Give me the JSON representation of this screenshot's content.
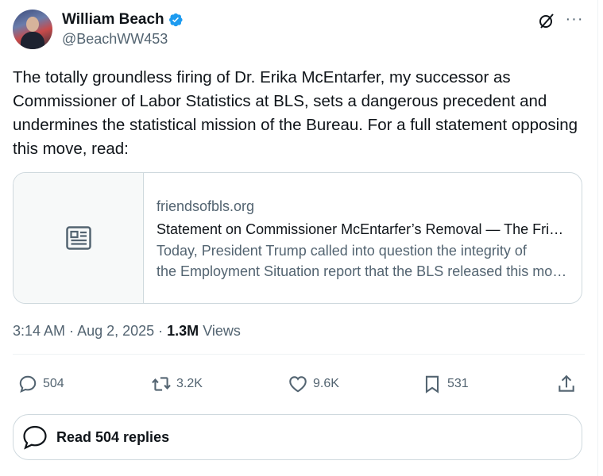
{
  "author": {
    "name": "William Beach",
    "handle": "@BeachWW453",
    "verified_color": "#1d9bf0"
  },
  "tweet": {
    "text": "The totally groundless firing of Dr. Erika McEntarfer, my successor as Commissioner of Labor Statistics at BLS, sets a dangerous precedent and undermines the statistical mission of the Bureau.  For a full statement opposing this move, read:"
  },
  "card": {
    "domain": "friendsofbls.org",
    "title": "Statement on Commissioner McEntarfer’s Removal — The Friends of BLS",
    "desc_line1": "Today, President Trump called into question the integrity of",
    "desc_line2": "the Employment Situation report that the BLS released this morning",
    "thumb_icon": "article-icon"
  },
  "meta": {
    "time": "3:14 AM",
    "sep1": " · ",
    "date": "Aug 2, 2025",
    "sep2": " · ",
    "views_count": "1.3M",
    "views_label": " Views"
  },
  "actions": {
    "replies": "504",
    "reposts": "3.2K",
    "likes": "9.6K",
    "bookmarks": "531"
  },
  "read_replies": {
    "label": "Read 504 replies"
  },
  "colors": {
    "text": "#0f1419",
    "muted": "#536471",
    "border": "#cfd9de",
    "accent": "#1d9bf0"
  }
}
